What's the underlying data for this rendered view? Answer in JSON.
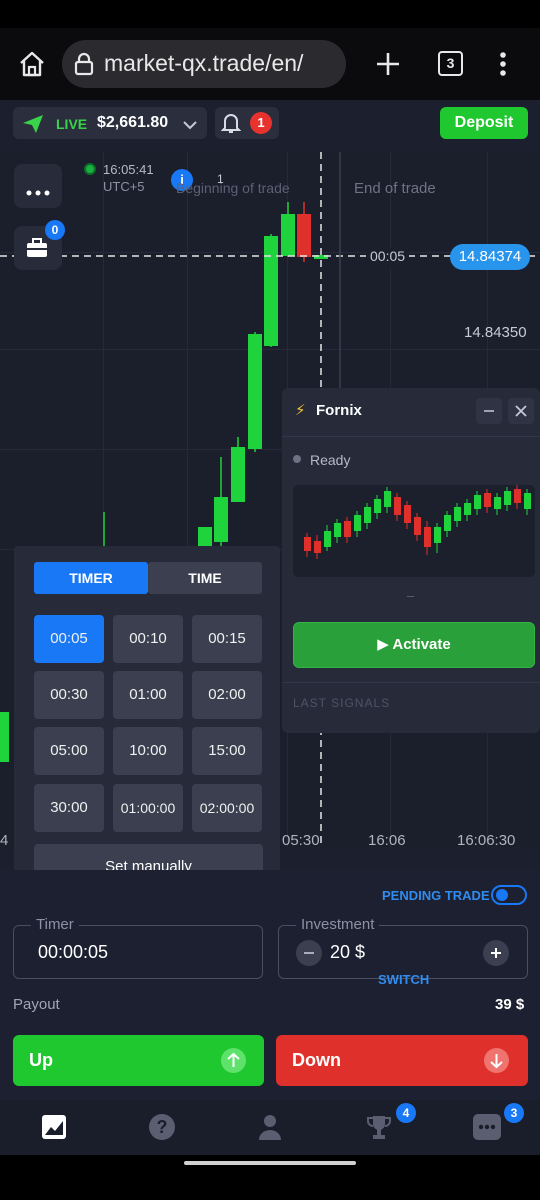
{
  "browser": {
    "url": "market-qx.trade/en/",
    "tab_count": "3"
  },
  "header": {
    "account_mode": "LIVE",
    "balance": "$2,661.80",
    "notification_count": "1",
    "deposit_label": "Deposit"
  },
  "chart": {
    "time": "16:05:41",
    "timezone": "UTC+5",
    "beginning_label": "Beginning of trade",
    "end_label": "End of trade",
    "marker_count": "1",
    "countdown": "00:05",
    "current_price": "14.84374",
    "price_level": "14.84350",
    "time_ticks": [
      "4",
      "05:30",
      "16:06",
      "16:06:30"
    ],
    "portfolio_count": "0"
  },
  "timer_panel": {
    "tab_timer": "TIMER",
    "tab_time": "TIME",
    "options": [
      "00:05",
      "00:10",
      "00:15",
      "00:30",
      "01:00",
      "02:00",
      "05:00",
      "10:00",
      "15:00",
      "30:00",
      "01:00:00",
      "02:00:00"
    ],
    "selected": "00:05",
    "set_manually": "Set manually"
  },
  "fornix": {
    "title": "Fornix",
    "status": "Ready",
    "dash": "–",
    "activate_label": "▶ Activate",
    "last_signals": "LAST SIGNALS"
  },
  "trade": {
    "pending_trade_label": "PENDING TRADE",
    "timer_label": "Timer",
    "timer_value": "00:00:05",
    "investment_label": "Investment",
    "investment_value": "20 $",
    "switch_label": "SWITCH",
    "payout_label": "Payout",
    "payout_value": "39 $",
    "up_label": "Up",
    "down_label": "Down"
  },
  "nav": {
    "trophy_badge": "4",
    "more_badge": "3"
  },
  "colors": {
    "up_green": "#1fc82f",
    "down_red": "#e0302b",
    "accent_blue": "#1978f5",
    "app_bg": "#1c1f2d"
  }
}
